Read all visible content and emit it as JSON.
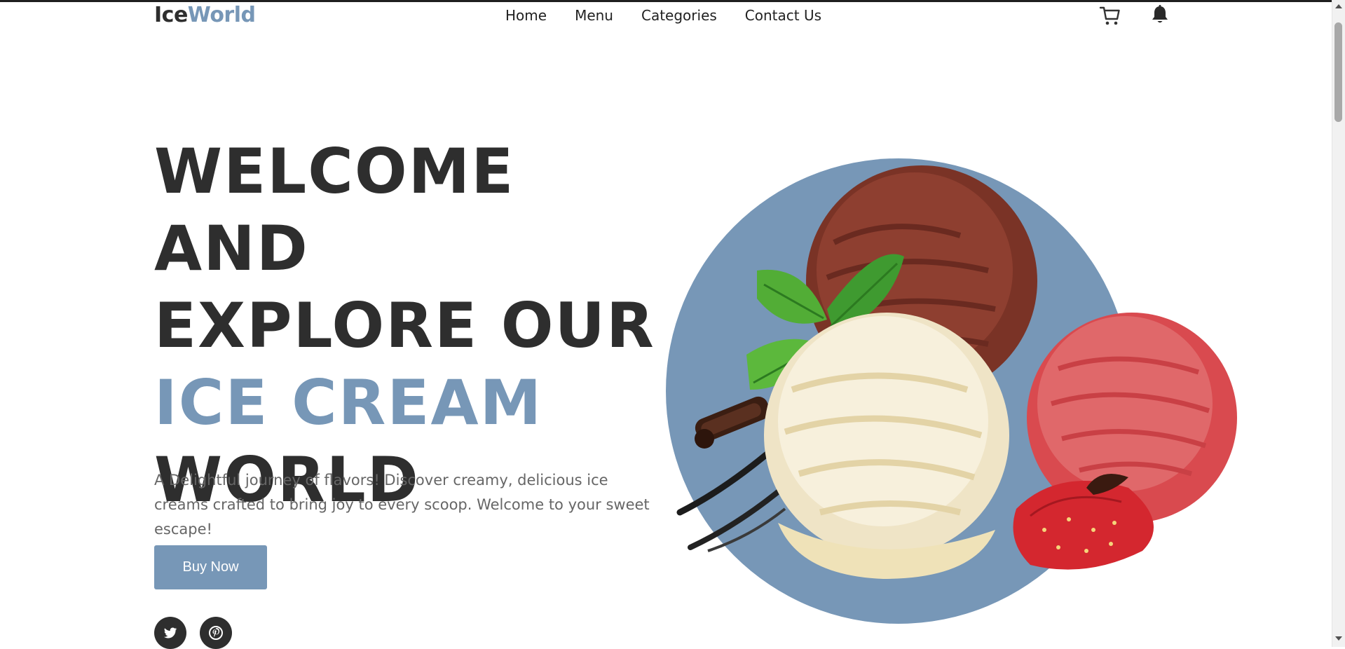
{
  "brand": {
    "logo_part1": "Ice",
    "logo_part2": "World",
    "accent_color": "#7797b7",
    "text_color": "#2e2e2e"
  },
  "nav": {
    "items": [
      {
        "label": "Home"
      },
      {
        "label": "Menu"
      },
      {
        "label": "Categories"
      },
      {
        "label": "Contact Us"
      }
    ],
    "icons": [
      "cart-icon",
      "bell-icon"
    ]
  },
  "hero": {
    "title_line1": "WELCOME AND",
    "title_line2": "EXPLORE OUR",
    "title_accent": "ICE CREAM",
    "title_line4": "WORLD",
    "description": "A Delightful journey of flavors! Discover creamy, delicious ice creams crafted to bring joy to every scoop. Welcome to your sweet escape!",
    "cta_label": "Buy Now",
    "image_subject": "ice-cream-scoops-illustration"
  },
  "social": {
    "icons": [
      "twitter-icon",
      "pinterest-icon"
    ]
  }
}
